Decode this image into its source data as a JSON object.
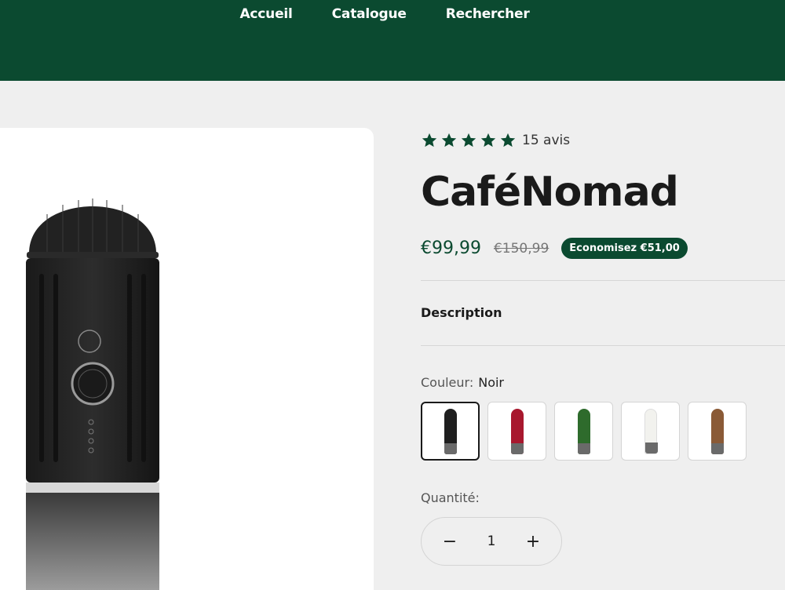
{
  "nav": {
    "items": [
      "Accueil",
      "Catalogue",
      "Rechercher"
    ]
  },
  "product": {
    "rating": 5,
    "reviews_label": "15 avis",
    "title": "CaféNomad",
    "price": "€99,99",
    "compare_price": "€150,99",
    "savings_badge": "Economisez €51,00",
    "description_label": "Description",
    "color_label": "Couleur:",
    "color_value": "Noir",
    "swatches": [
      {
        "name": "Noir",
        "color": "#1f1f1f"
      },
      {
        "name": "Rouge",
        "color": "#a8182e"
      },
      {
        "name": "Vert",
        "color": "#2e6b2c"
      },
      {
        "name": "Blanc",
        "color": "#f2f2ee"
      },
      {
        "name": "Bois",
        "color": "#8a5a36"
      }
    ],
    "quantity_label": "Quantité:",
    "quantity": "1",
    "minus": "−",
    "plus": "+"
  },
  "colors": {
    "brand": "#0b4a30",
    "background": "#efefef"
  }
}
